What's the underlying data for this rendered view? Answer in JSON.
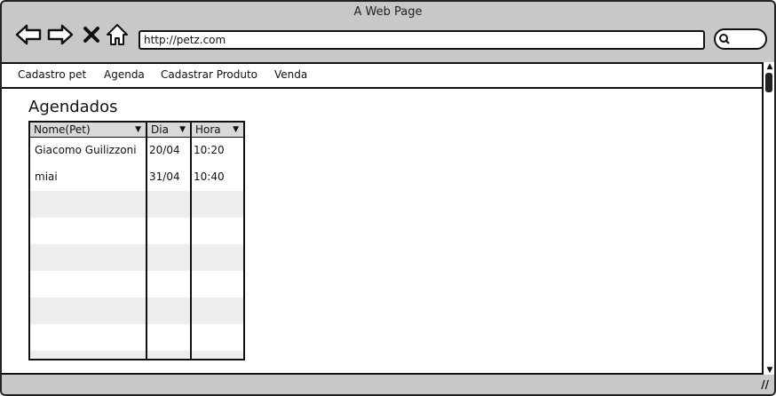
{
  "window": {
    "title": "A Web Page"
  },
  "browser": {
    "url": "http://petz.com"
  },
  "menu": {
    "items": [
      "Cadastro pet",
      "Agenda",
      "Cadastrar Produto",
      "Venda"
    ]
  },
  "page": {
    "heading": "Agendados"
  },
  "table": {
    "columns": [
      "Nome(Pet)",
      "Dia",
      "Hora"
    ],
    "rows": [
      {
        "nome": "Giacomo Guilizzoni",
        "dia": "20/04",
        "hora": "10:20"
      },
      {
        "nome": "miai",
        "dia": "31/04",
        "hora": "10:40"
      }
    ]
  },
  "icons": [
    "back-arrow-icon",
    "forward-arrow-icon",
    "close-icon",
    "home-icon",
    "search-icon",
    "resize-grip-icon"
  ]
}
